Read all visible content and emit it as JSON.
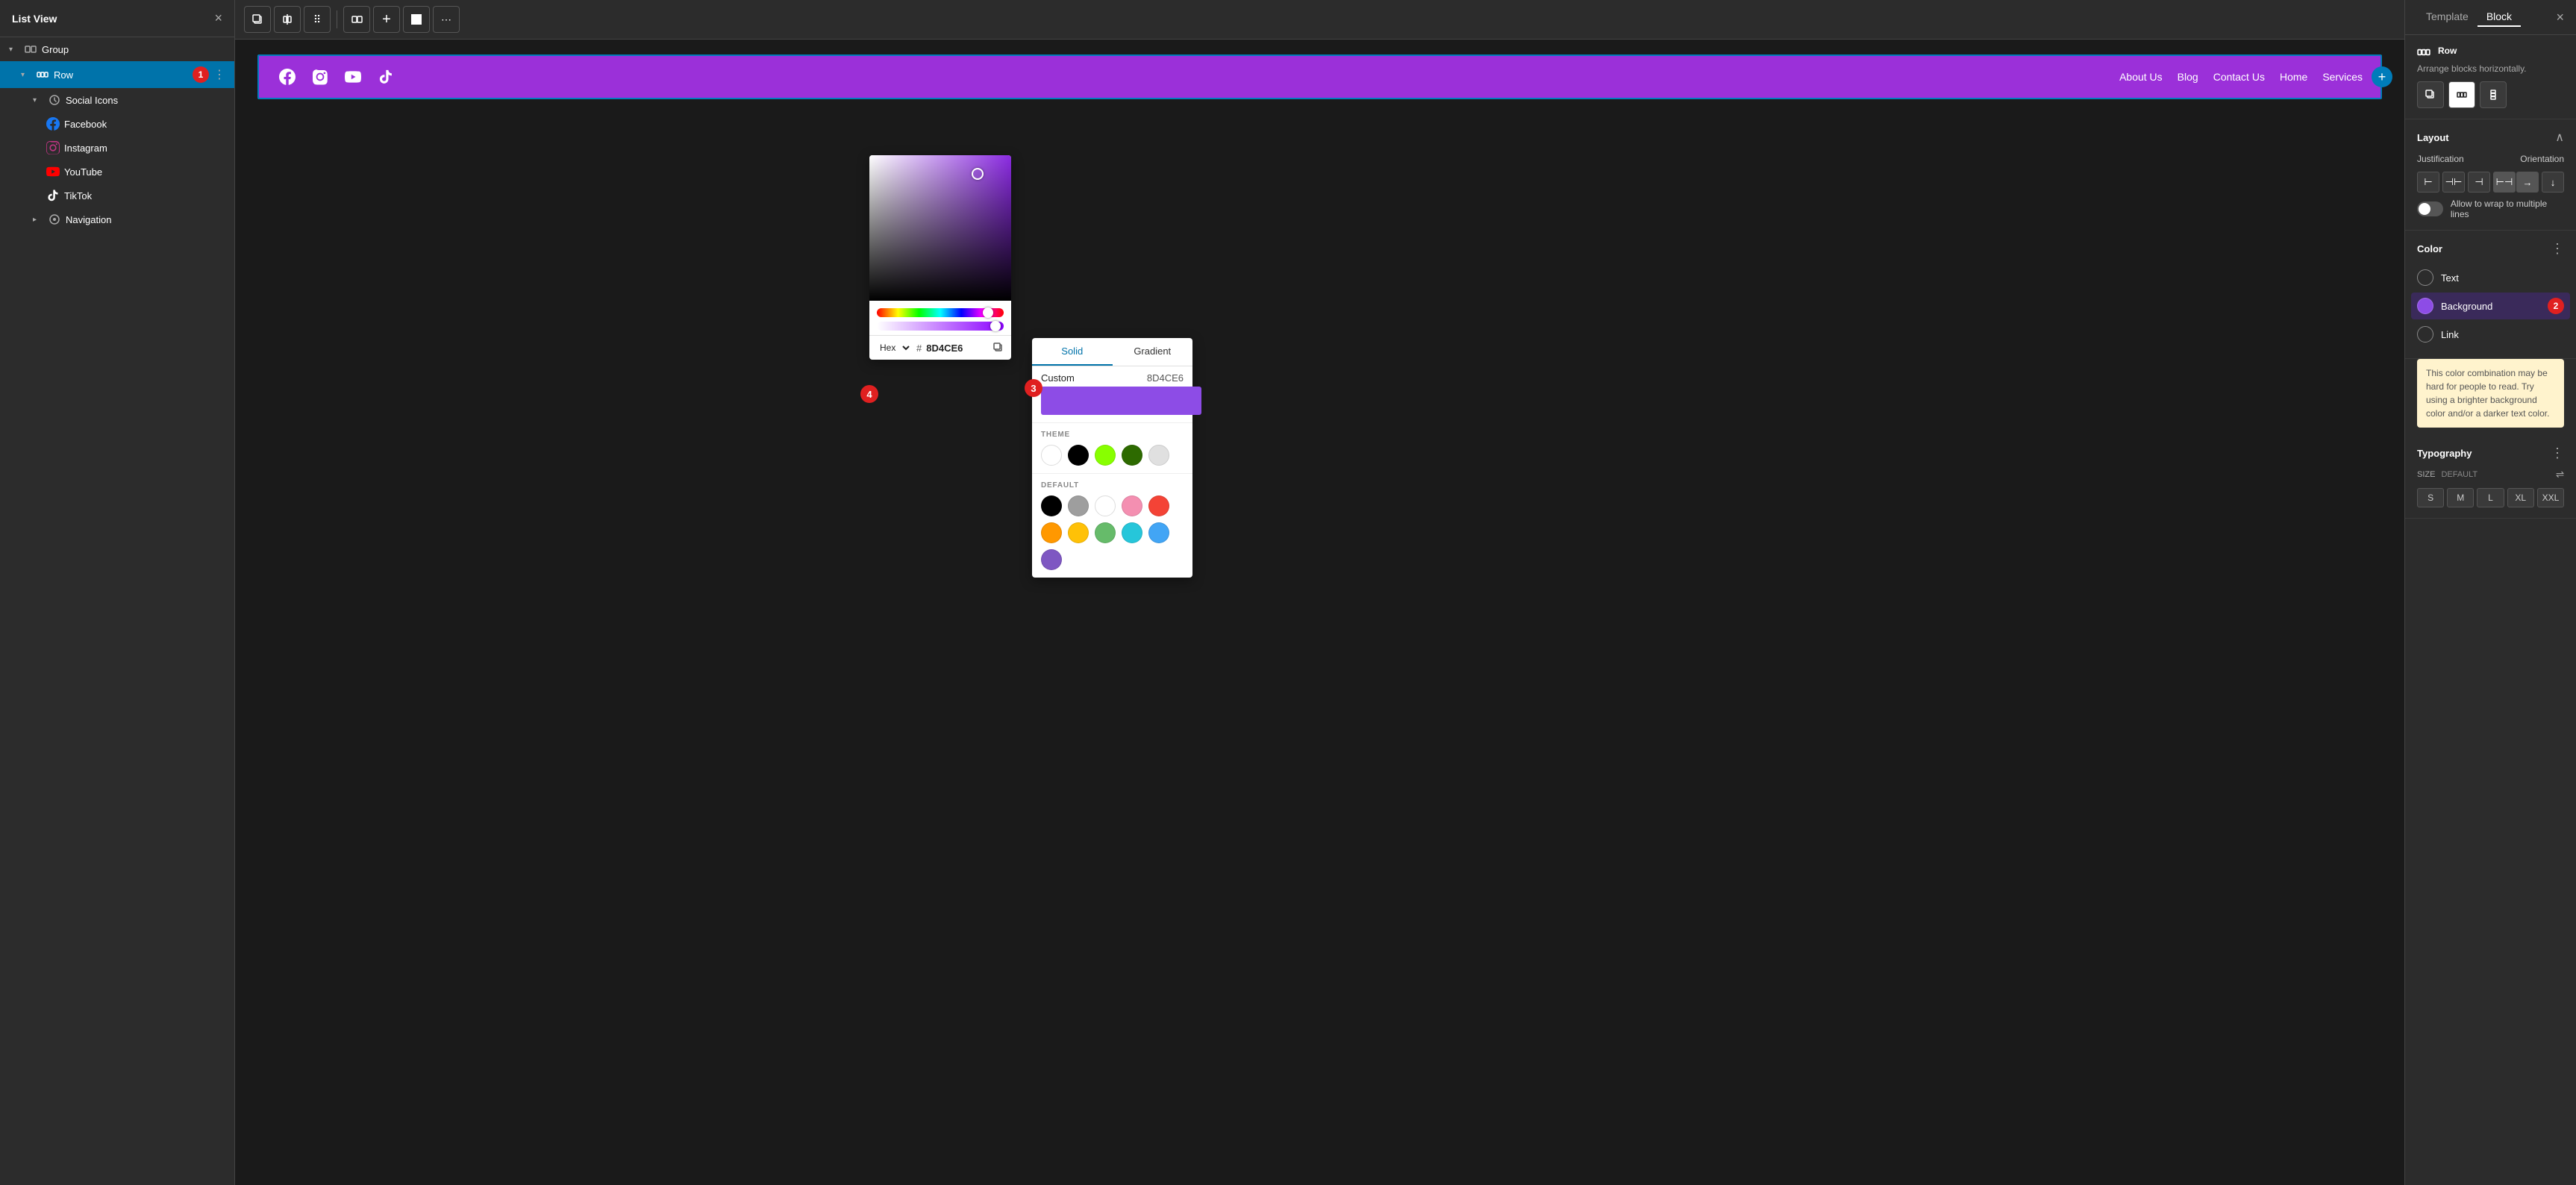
{
  "left_panel": {
    "title": "List View",
    "close_icon": "×",
    "tree": [
      {
        "id": "group",
        "level": 0,
        "label": "Group",
        "icon": "group",
        "chevron": "▾",
        "expanded": true
      },
      {
        "id": "row",
        "level": 1,
        "label": "Row",
        "icon": "row",
        "chevron": "▾",
        "expanded": true,
        "selected": true,
        "badge": "1"
      },
      {
        "id": "social-icons",
        "level": 2,
        "label": "Social Icons",
        "icon": "social",
        "chevron": "▾",
        "expanded": true
      },
      {
        "id": "facebook",
        "level": 3,
        "label": "Facebook",
        "icon": "facebook"
      },
      {
        "id": "instagram",
        "level": 3,
        "label": "Instagram",
        "icon": "instagram"
      },
      {
        "id": "youtube",
        "level": 3,
        "label": "YouTube",
        "icon": "youtube"
      },
      {
        "id": "tiktok",
        "level": 3,
        "label": "TikTok",
        "icon": "tiktok"
      },
      {
        "id": "navigation",
        "level": 2,
        "label": "Navigation",
        "icon": "navigation",
        "chevron": "▸",
        "expanded": false
      }
    ]
  },
  "canvas": {
    "toolbar_buttons": [
      "duplicate",
      "align-center",
      "drag",
      "align-left",
      "add",
      "square",
      "more"
    ],
    "header": {
      "bg_color": "#9b30d9",
      "social_icons": [
        "facebook",
        "instagram",
        "youtube",
        "tiktok"
      ],
      "nav_links": [
        "About Us",
        "Blog",
        "Contact Us",
        "Home",
        "Services"
      ]
    }
  },
  "color_picker": {
    "hex_label": "Hex",
    "hex_value": "8D4CE6",
    "hex_prefix": "#",
    "badge": "4"
  },
  "solid_gradient_popup": {
    "tabs": [
      "Solid",
      "Gradient"
    ],
    "active_tab": "Solid",
    "custom_label": "Custom",
    "custom_hex": "8D4CE6",
    "theme_title": "THEME",
    "theme_colors": [
      "#ffffff",
      "#000000",
      "#88ff00",
      "#2d6a00",
      "#e0e0e0"
    ],
    "default_title": "DEFAULT",
    "default_colors": [
      "#000000",
      "#9e9e9e",
      "#ffffff",
      "#f48fb1",
      "#f44336",
      "#ff9800",
      "#ffc107",
      "#66bb6a",
      "#26c6da",
      "#42a5f5",
      "#7e57c2"
    ],
    "badge": "3"
  },
  "right_panel": {
    "tabs": [
      "Template",
      "Block"
    ],
    "active_tab": "Block",
    "close_icon": "×",
    "block_type": "Row",
    "block_desc": "Arrange blocks horizontally.",
    "layout": {
      "title": "Layout",
      "justification_label": "Justification",
      "orientation_label": "Orientation",
      "justify_buttons": [
        "align-left",
        "align-center",
        "align-right",
        "align-stretch"
      ],
      "orient_buttons": [
        "orient-h",
        "orient-v"
      ],
      "wrap_label": "Allow to wrap to multiple lines"
    },
    "color": {
      "title": "Color",
      "options": [
        {
          "id": "text",
          "label": "Text",
          "color": null
        },
        {
          "id": "background",
          "label": "Background",
          "color": "#8D4CE6",
          "highlighted": true
        },
        {
          "id": "link",
          "label": "Link",
          "color": null
        }
      ],
      "warning": "This color combination may be hard for people to read. Try using a brighter background color and/or a darker text color.",
      "badge": "2"
    },
    "typography": {
      "title": "Typography",
      "size_label": "SIZE",
      "size_value": "DEFAULT",
      "sizes": [
        "S",
        "M",
        "L",
        "XL",
        "XXL"
      ]
    }
  }
}
